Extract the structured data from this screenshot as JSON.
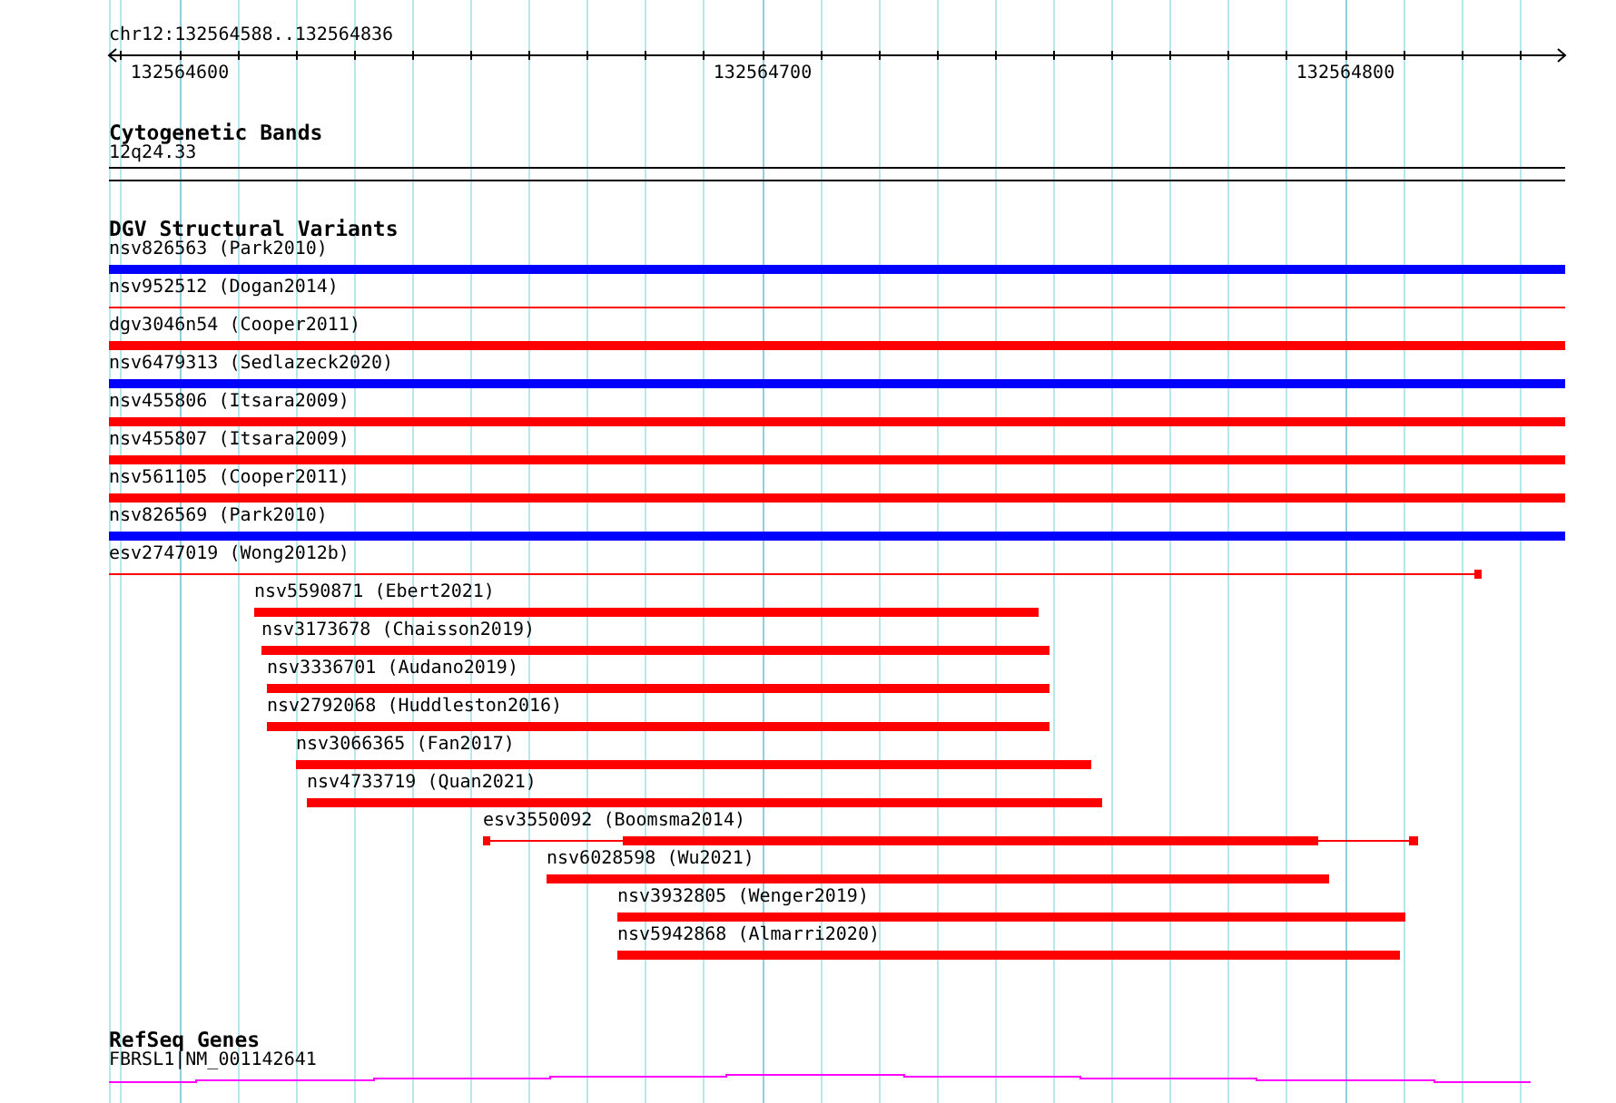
{
  "location": "chr12:132564588..132564836",
  "ruler": {
    "ticks": [
      "132564600",
      "132564700",
      "132564800"
    ]
  },
  "cytogenetic_bands": {
    "title": "Cytogenetic Bands",
    "band": {
      "label": "12q24.33"
    }
  },
  "dgv_structural_variants": {
    "title": "DGV Structural Variants",
    "features": [
      {
        "label": "nsv826563 (Park2010)",
        "color": "#0000ff",
        "kind": "bar"
      },
      {
        "label": "nsv952512 (Dogan2014)",
        "color": "#ff0000",
        "kind": "line"
      },
      {
        "label": "dgv3046n54 (Cooper2011)",
        "color": "#ff0000",
        "kind": "bar"
      },
      {
        "label": "nsv6479313 (Sedlazeck2020)",
        "color": "#0000ff",
        "kind": "bar"
      },
      {
        "label": "nsv455806 (Itsara2009)",
        "color": "#ff0000",
        "kind": "bar"
      },
      {
        "label": "nsv455807 (Itsara2009)",
        "color": "#ff0000",
        "kind": "bar"
      },
      {
        "label": "nsv561105 (Cooper2011)",
        "color": "#ff0000",
        "kind": "bar"
      },
      {
        "label": "nsv826569 (Park2010)",
        "color": "#0000ff",
        "kind": "bar"
      },
      {
        "label": "esv2747019 (Wong2012b)",
        "color": "#ff0000",
        "kind": "line-box"
      },
      {
        "label": "nsv5590871 (Ebert2021)",
        "color": "#ff0000",
        "kind": "bar"
      },
      {
        "label": "nsv3173678 (Chaisson2019)",
        "color": "#ff0000",
        "kind": "bar"
      },
      {
        "label": "nsv3336701 (Audano2019)",
        "color": "#ff0000",
        "kind": "bar"
      },
      {
        "label": "nsv2792068 (Huddleston2016)",
        "color": "#ff0000",
        "kind": "bar"
      },
      {
        "label": "nsv3066365 (Fan2017)",
        "color": "#ff0000",
        "kind": "bar"
      },
      {
        "label": "nsv4733719 (Quan2021)",
        "color": "#ff0000",
        "kind": "bar"
      },
      {
        "label": "esv3550092 (Boomsma2014)",
        "color": "#ff0000",
        "kind": "gapped"
      },
      {
        "label": "nsv6028598 (Wu2021)",
        "color": "#ff0000",
        "kind": "bar"
      },
      {
        "label": "nsv3932805 (Wenger2019)",
        "color": "#ff0000",
        "kind": "bar"
      },
      {
        "label": "nsv5942868 (Almarri2020)",
        "color": "#ff0000",
        "kind": "bar"
      }
    ]
  },
  "refseq_genes": {
    "title": "RefSeq Genes",
    "genes": [
      {
        "label": "FBRSL1|NM_001142641"
      }
    ]
  }
}
